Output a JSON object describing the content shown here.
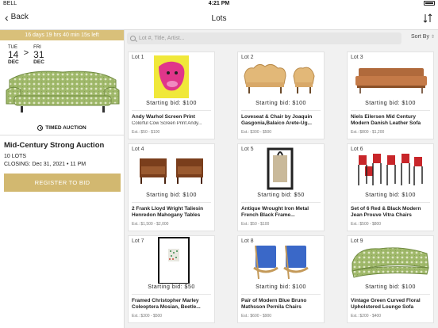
{
  "status": {
    "carrier": "BELL",
    "time": "4:21 PM"
  },
  "nav": {
    "back_label": "Back",
    "title": "Lots"
  },
  "auction": {
    "countdown": "16 days 19 hrs 40 min 15s left",
    "start": {
      "dow": "TUE",
      "day": "14",
      "month": "DEC"
    },
    "end": {
      "dow": "FRI",
      "day": "31",
      "month": "DEC"
    },
    "type_label": "TIMED AUCTION",
    "title": "Mid-Century Strong Auction",
    "lot_count": "10 LOTS",
    "closing": "CLOSING: Dec 31, 2021 • 11 PM",
    "register_label": "REGISTER TO BID"
  },
  "search": {
    "placeholder": "Lot #, Title, Artist...",
    "sort_label": "Sort By"
  },
  "lots": [
    {
      "lot": "Lot 1",
      "bid": "Starting bid: $100",
      "name": "Andy Warhol Screen Print",
      "sub": "Colorful Cow Screen Print Andy...",
      "est": "Est.: $50 - $100",
      "image": "warhol-cow-print"
    },
    {
      "lot": "Lot 2",
      "bid": "Starting bid: $100",
      "name": "Loveseat & Chair by Joaquin Gasgonia,Balaico Arete-Ug...",
      "sub": "",
      "est": "Est.: $300 - $500",
      "image": "loveseat-chair"
    },
    {
      "lot": "Lot 3",
      "bid": "Starting bid: $100",
      "name": "Niels Eilersen Mid Century Modern Danish Leather Sofa",
      "sub": "",
      "est": "Est.: $800 - $1,200",
      "image": "leather-sofa"
    },
    {
      "lot": "Lot 4",
      "bid": "Starting bid: $100",
      "name": "2 Frank Lloyd Wright Taliesin Henredon Mahogany Tables",
      "sub": "",
      "est": "Est.: $1,500 - $2,000",
      "image": "mahogany-tables"
    },
    {
      "lot": "Lot 5",
      "bid": "Starting bid: $50",
      "name": "Antique Wrought Iron Metal French Black Frame...",
      "sub": "",
      "est": "Est.: $50 - $100",
      "image": "iron-frame"
    },
    {
      "lot": "Lot 6",
      "bid": "Starting bid: $100",
      "name": "Set of 6 Red & Black Modern Jean Prouve Vitra Chairs",
      "sub": "",
      "est": "Est.: $500 - $800",
      "image": "red-chairs"
    },
    {
      "lot": "Lot 7",
      "bid": "Starting bid: $50",
      "name": "Framed Christopher Marley Coleoptera Mosian, Beetle...",
      "sub": "",
      "est": "Est.: $300 - $500",
      "image": "beetle-frame"
    },
    {
      "lot": "Lot 8",
      "bid": "Starting bid: $100",
      "name": "Pair of Modern Blue Bruno Mathsson Pernila Chairs",
      "sub": "",
      "est": "Est.: $600 - $900",
      "image": "blue-chairs"
    },
    {
      "lot": "Lot 9",
      "bid": "Starting bid: $100",
      "name": "Vintage Green Curved Floral Upholstered Lounge Sofa",
      "sub": "",
      "est": "Est.: $200 - $400",
      "image": "green-sofa"
    }
  ],
  "colors": {
    "accent": "#d2b870",
    "countdown_bg": "#d9c07a"
  }
}
